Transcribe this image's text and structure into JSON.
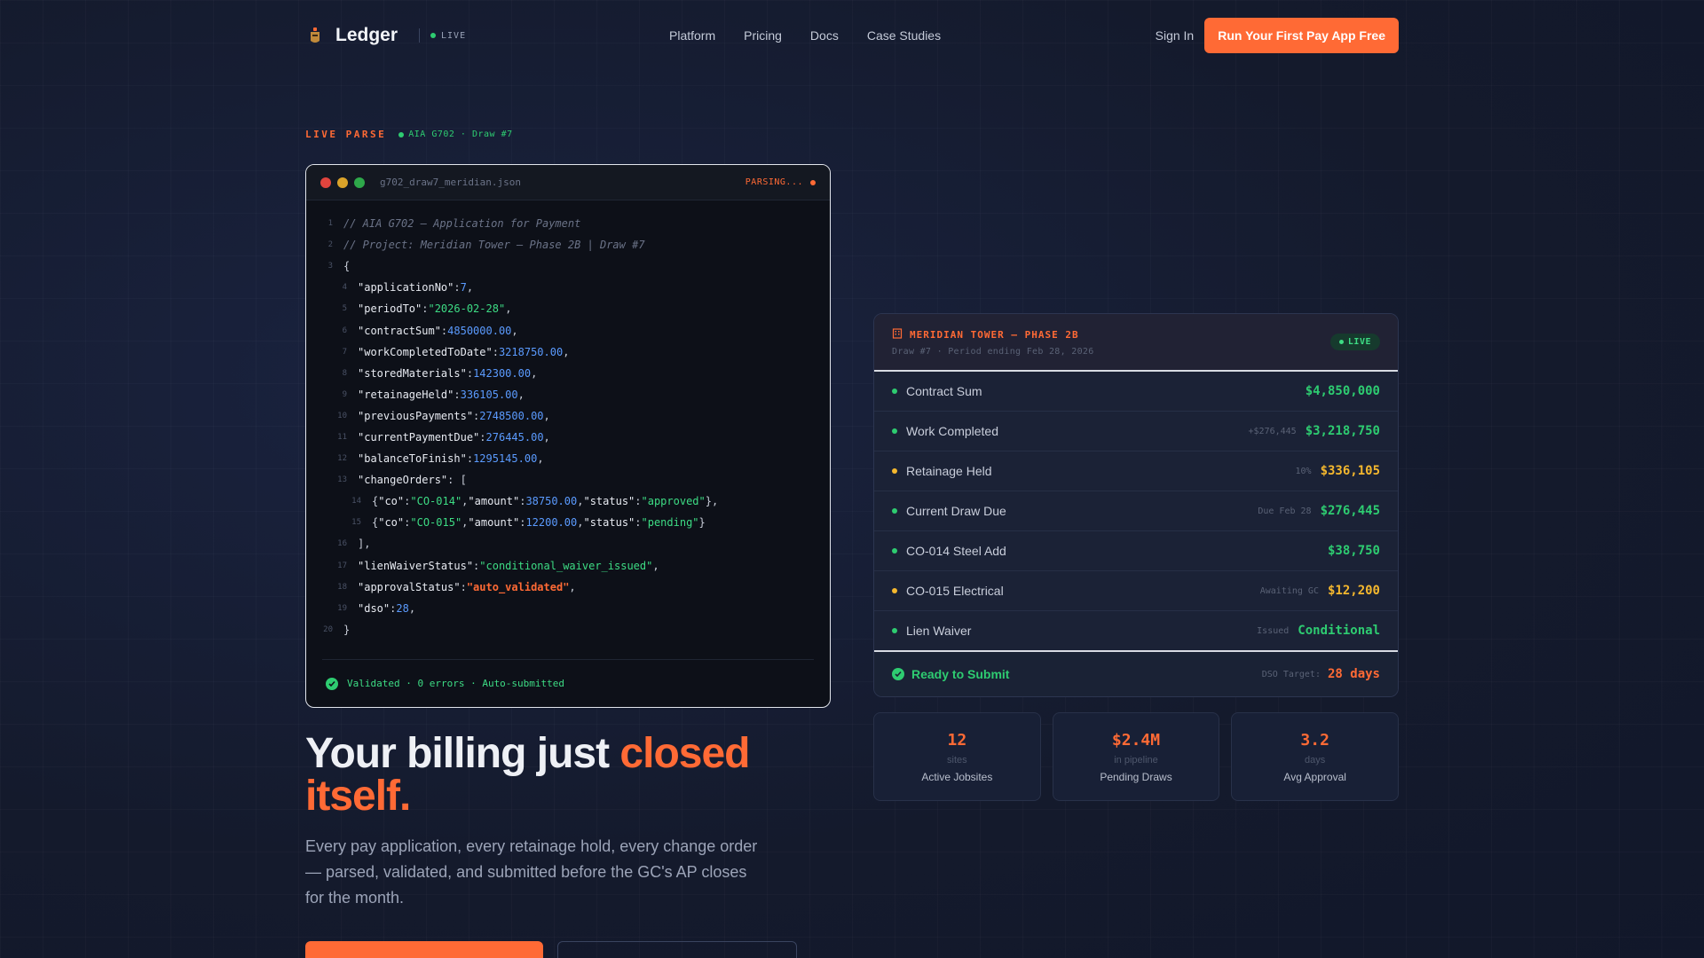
{
  "nav": {
    "brand": "Ledger",
    "live": "LIVE",
    "links": [
      "Platform",
      "Pricing",
      "Docs",
      "Case Studies"
    ],
    "signin": "Sign In",
    "cta": "Run Your First Pay App Free"
  },
  "eyebrow": {
    "label": "LIVE PARSE",
    "doc": "AIA G702 · Draw #7"
  },
  "code": {
    "filename": "g702_draw7_meridian.json",
    "status": "PARSING...",
    "footer": "Validated · 0 errors · Auto-submitted"
  },
  "hero": {
    "headline_main": "Your billing just ",
    "headline_accent": "closed itself.",
    "subtext": "Every pay application, every retainage hold, every change order — parsed, validated, and submitted before the GC's AP closes for the month."
  },
  "card": {
    "title": "MERIDIAN TOWER — PHASE 2B",
    "subtitle": "Draw #7 · Period ending Feb 28, 2026",
    "badge": "LIVE",
    "rows": [
      {
        "label": "Contract Sum",
        "note": "",
        "value": "$4,850,000",
        "color": "#2ecc71"
      },
      {
        "label": "Work Completed",
        "note": "+$276,445",
        "value": "$3,218,750",
        "color": "#2ecc71"
      },
      {
        "label": "Retainage Held",
        "note": "10%",
        "value": "$336,105",
        "color": "#f5b82e"
      },
      {
        "label": "Current Draw Due",
        "note": "Due Feb 28",
        "value": "$276,445",
        "color": "#2ecc71"
      },
      {
        "label": "CO-014 Steel Add",
        "note": "",
        "value": "$38,750",
        "color": "#2ecc71"
      },
      {
        "label": "CO-015 Electrical",
        "note": "Awaiting GC",
        "value": "$12,200",
        "color": "#f5b82e"
      },
      {
        "label": "Lien Waiver",
        "note": "Issued",
        "value": "Conditional",
        "color": "#2ecc71"
      }
    ],
    "footer_status": "Ready to Submit",
    "dso_label": "DSO Target:",
    "dso_value": "28 days"
  },
  "stats": [
    {
      "num": "12",
      "unit": "sites",
      "label": "Active Jobsites"
    },
    {
      "num": "$2.4M",
      "unit": "in pipeline",
      "label": "Pending Draws"
    },
    {
      "num": "3.2",
      "unit": "days",
      "label": "Avg Approval"
    }
  ]
}
